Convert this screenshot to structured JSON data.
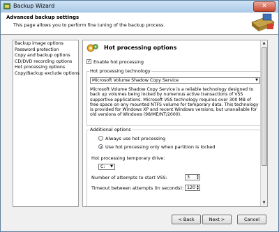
{
  "window": {
    "title": "Backup Wizard",
    "close_glyph": "✕"
  },
  "header": {
    "title": "Advanced backup settings",
    "subtitle": "This page allows you to perform fine tuning of the backup process."
  },
  "nav": {
    "items": [
      {
        "label": "Backup image options"
      },
      {
        "label": "Password protection"
      },
      {
        "label": "Copy and backup options"
      },
      {
        "label": "CD/DVD recording options"
      },
      {
        "label": "Hot processing options"
      },
      {
        "label": "Copy/Backup exclude options"
      }
    ],
    "selected_index": 4
  },
  "panel": {
    "title": "Hot processing options",
    "enable_label": "Enable hot processing",
    "enable_checked": true,
    "technology_legend": "Hot processing technology",
    "technology_value": "Microsoft Volume Shadow Copy Service",
    "description": "Microsoft Volume Shadow Copy Service is a reliable technology designed to back up volumes being locked by numerous active transactions of VSS supportive applications. Microsoft VSS technology requires over 300 MB of free space on any mounted NTFS volume for temporary data. This technology is provided for Windows XP and recent Windows versions, but unavailable for old versions of Windows (98/ME/NT/2000).",
    "additional_legend": "Additional options",
    "radio_always": "Always use hot processing",
    "radio_locked": "Use hot processing only when partition is locked",
    "temp_drive_label": "Hot processing temporary drive:",
    "temp_drive_value": "C:",
    "attempts_label": "Number of attempts to start VSS:",
    "attempts_value": "3",
    "timeout_label": "Timeout between attempts (in seconds):",
    "timeout_value": "120"
  },
  "buttons": {
    "back": "< Back",
    "next": "Next >",
    "cancel": "Cancel"
  },
  "colors": {
    "title_gradient_top": "#cfe3f5",
    "close_red": "#c7452c"
  }
}
